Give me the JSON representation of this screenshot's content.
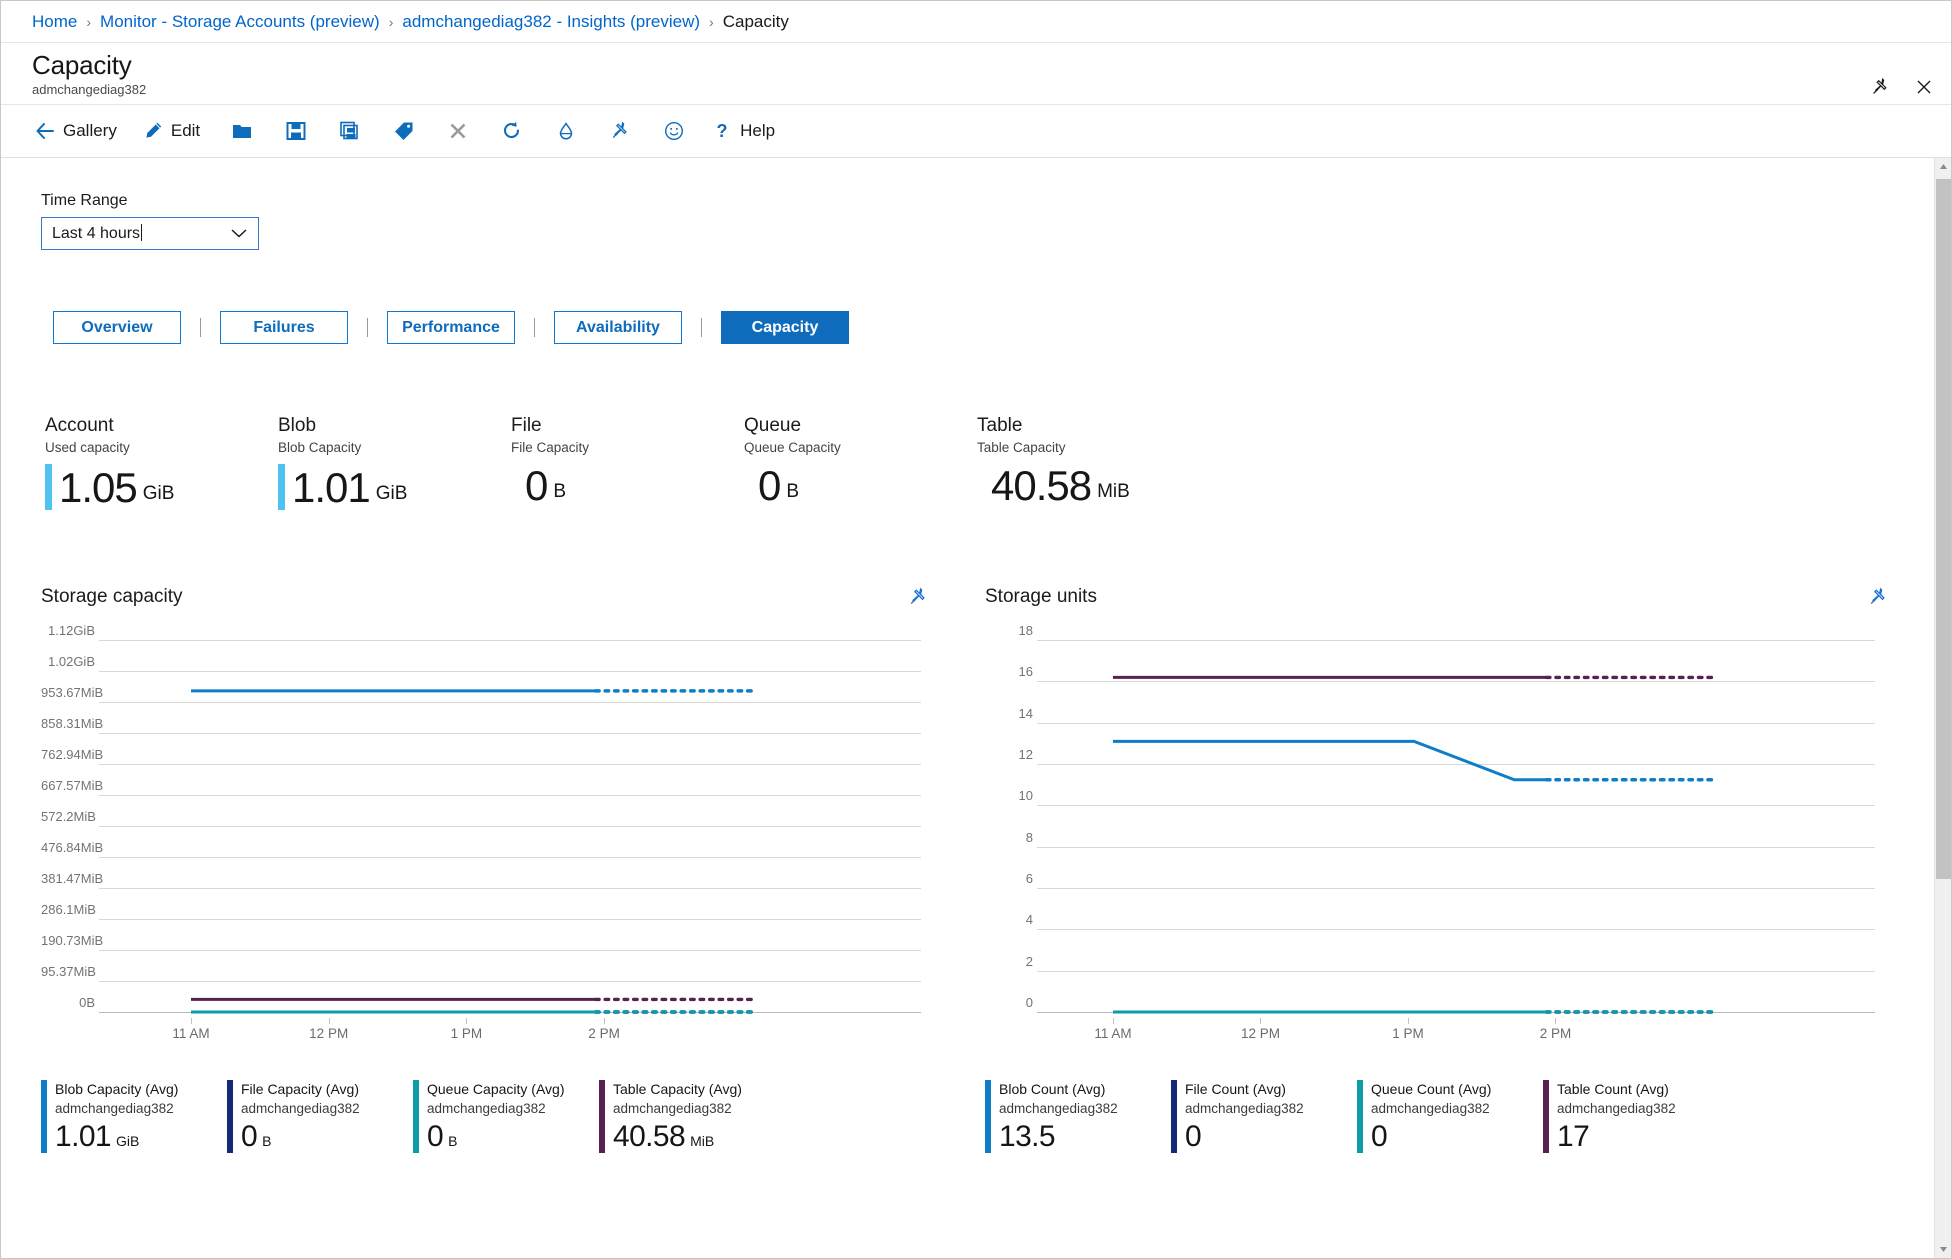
{
  "breadcrumb": {
    "items": [
      {
        "label": "Home",
        "current": false
      },
      {
        "label": "Monitor - Storage Accounts (preview)",
        "current": false
      },
      {
        "label": "admchangediag382 - Insights (preview)",
        "current": false
      },
      {
        "label": "Capacity",
        "current": true
      }
    ],
    "separator": "›"
  },
  "header": {
    "title": "Capacity",
    "subtitle": "admchangediag382",
    "pin_icon": "pin-icon",
    "close_icon": "close-icon"
  },
  "toolbar": {
    "items": [
      {
        "label": "Gallery",
        "icon": "back-arrow-icon"
      },
      {
        "label": "Edit",
        "icon": "pencil-icon"
      },
      {
        "label": "",
        "icon": "folder-icon"
      },
      {
        "label": "",
        "icon": "save-icon"
      },
      {
        "label": "",
        "icon": "save-as-icon"
      },
      {
        "label": "",
        "icon": "tag-icon"
      },
      {
        "label": "",
        "icon": "close-x-icon"
      },
      {
        "label": "",
        "icon": "refresh-icon"
      },
      {
        "label": "",
        "icon": "cloud-share-icon"
      },
      {
        "label": "",
        "icon": "pin-icon"
      },
      {
        "label": "",
        "icon": "feedback-smiley-icon"
      },
      {
        "label": "Help",
        "icon": "question-mark-icon"
      }
    ]
  },
  "time_range": {
    "label": "Time Range",
    "value": "Last 4 hours",
    "chevron_icon": "chevron-down-icon"
  },
  "tabs": [
    {
      "label": "Overview",
      "active": false
    },
    {
      "label": "Failures",
      "active": false
    },
    {
      "label": "Performance",
      "active": false
    },
    {
      "label": "Availability",
      "active": false
    },
    {
      "label": "Capacity",
      "active": true
    }
  ],
  "kpis": [
    {
      "title": "Account",
      "subtitle": "Used capacity",
      "value": "1.05",
      "unit": "GiB",
      "accent": "#4ec3f0",
      "has_bar": true
    },
    {
      "title": "Blob",
      "subtitle": "Blob Capacity",
      "value": "1.01",
      "unit": "GiB",
      "accent": "#4ec3f0",
      "has_bar": true
    },
    {
      "title": "File",
      "subtitle": "File Capacity",
      "value": "0",
      "unit": "B",
      "accent": "#ffffff",
      "has_bar": false
    },
    {
      "title": "Queue",
      "subtitle": "Queue Capacity",
      "value": "0",
      "unit": "B",
      "accent": "#ffffff",
      "has_bar": false
    },
    {
      "title": "Table",
      "subtitle": "Table Capacity",
      "value": "40.58",
      "unit": "MiB",
      "accent": "#ffffff",
      "has_bar": false
    }
  ],
  "charts": [
    {
      "title": "Storage capacity",
      "pin_icon": "pin-icon"
    },
    {
      "title": "Storage units",
      "pin_icon": "pin-icon"
    }
  ],
  "chart_data": [
    {
      "type": "line",
      "title": "Storage capacity",
      "xlabel": "",
      "ylabel": "",
      "grid": true,
      "legend_position": "bottom",
      "x_ticks": [
        "11 AM",
        "12 PM",
        "1 PM",
        "2 PM"
      ],
      "y_ticks": [
        "1.12GiB",
        "1.02GiB",
        "953.67MiB",
        "858.31MiB",
        "762.94MiB",
        "667.57MiB",
        "572.2MiB",
        "476.84MiB",
        "381.47MiB",
        "286.1MiB",
        "190.73MiB",
        "95.37MiB",
        "0B"
      ],
      "ylim_bytes": [
        0,
        1202590843
      ],
      "series": [
        {
          "name": "Blob Capacity (Avg)",
          "resource": "admchangediag382",
          "color": "#0f7ec8",
          "current_value": "1.01",
          "current_unit": "GiB",
          "values_gib": [
            1.01,
            1.01,
            1.01,
            1.01,
            1.01,
            1.01,
            1.01
          ],
          "dashed_tail_from": 0.72
        },
        {
          "name": "File Capacity (Avg)",
          "resource": "admchangediag382",
          "color": "#152a74",
          "current_value": "0",
          "current_unit": "B",
          "values_gib": [
            0,
            0,
            0,
            0,
            0,
            0,
            0
          ],
          "dashed_tail_from": 0.72
        },
        {
          "name": "Queue Capacity (Avg)",
          "resource": "admchangediag382",
          "color": "#0f9aa8",
          "current_value": "0",
          "current_unit": "B",
          "values_gib": [
            0,
            0,
            0,
            0,
            0,
            0,
            0
          ],
          "dashed_tail_from": 0.72
        },
        {
          "name": "Table Capacity (Avg)",
          "resource": "admchangediag382",
          "color": "#59214f",
          "current_value": "40.58",
          "current_unit": "MiB",
          "values_gib": [
            0.0396,
            0.0396,
            0.0396,
            0.0396,
            0.0396,
            0.0396,
            0.0396
          ],
          "dashed_tail_from": 0.72
        }
      ]
    },
    {
      "type": "line",
      "title": "Storage units",
      "xlabel": "",
      "ylabel": "",
      "grid": true,
      "legend_position": "bottom",
      "x_ticks": [
        "11 AM",
        "12 PM",
        "1 PM",
        "2 PM"
      ],
      "y_ticks": [
        "18",
        "16",
        "14",
        "12",
        "10",
        "8",
        "6",
        "4",
        "2",
        "0"
      ],
      "ylim": [
        0,
        18
      ],
      "series": [
        {
          "name": "Blob Count (Avg)",
          "resource": "admchangediag382",
          "color": "#0f7ec8",
          "current_value": "13.5",
          "current_unit": "",
          "values": [
            13.75,
            13.75,
            13.75,
            13.75,
            11.8,
            11.8,
            11.8
          ],
          "dashed_tail_from": 0.72
        },
        {
          "name": "File Count (Avg)",
          "resource": "admchangediag382",
          "color": "#152a74",
          "current_value": "0",
          "current_unit": "",
          "values": [
            0,
            0,
            0,
            0,
            0,
            0,
            0
          ],
          "dashed_tail_from": 0.72
        },
        {
          "name": "Queue Count (Avg)",
          "resource": "admchangediag382",
          "color": "#0f9aa8",
          "current_value": "0",
          "current_unit": "",
          "values": [
            0,
            0,
            0,
            0,
            0,
            0,
            0
          ],
          "dashed_tail_from": 0.72
        },
        {
          "name": "Table Count (Avg)",
          "resource": "admchangediag382",
          "color": "#59214f",
          "current_value": "17",
          "current_unit": "",
          "values": [
            17,
            17,
            17,
            17,
            17,
            17,
            17
          ],
          "dashed_tail_from": 0.72
        }
      ]
    }
  ],
  "scrollbar": {
    "up_icon": "scroll-up-arrow-icon",
    "down_icon": "scroll-down-arrow-icon"
  }
}
